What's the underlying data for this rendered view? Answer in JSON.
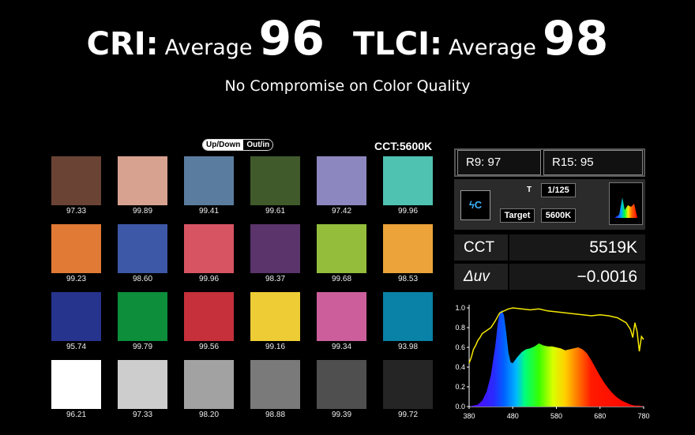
{
  "header": {
    "cri_label": "CRI:",
    "cri_avg_label": "Average",
    "cri_value": "96",
    "tlci_label": "TLCI:",
    "tlci_avg_label": "Average",
    "tlci_value": "98",
    "subtitle": "No Compromise on Color Quality"
  },
  "toggle": {
    "option_1": "Up/Down",
    "option_2": "Out/in"
  },
  "chart_title": "CCT:5600K",
  "swatches": [
    {
      "value": "97.33",
      "color": "#6a4335"
    },
    {
      "value": "99.89",
      "color": "#d8a291"
    },
    {
      "value": "99.41",
      "color": "#5a7c9e"
    },
    {
      "value": "99.61",
      "color": "#415a2b"
    },
    {
      "value": "97.42",
      "color": "#8c87bf"
    },
    {
      "value": "99.96",
      "color": "#4fc2b2"
    },
    {
      "value": "99.23",
      "color": "#e17a35"
    },
    {
      "value": "98.60",
      "color": "#3d58a6"
    },
    {
      "value": "99.96",
      "color": "#d75462"
    },
    {
      "value": "98.37",
      "color": "#5a346a"
    },
    {
      "value": "99.68",
      "color": "#94bd3c"
    },
    {
      "value": "98.53",
      "color": "#eca33a"
    },
    {
      "value": "95.74",
      "color": "#26348e"
    },
    {
      "value": "99.79",
      "color": "#0c8e3b"
    },
    {
      "value": "99.56",
      "color": "#c5303a"
    },
    {
      "value": "99.16",
      "color": "#eecc35"
    },
    {
      "value": "99.34",
      "color": "#cc5f9b"
    },
    {
      "value": "93.98",
      "color": "#0a81a6"
    },
    {
      "value": "96.21",
      "color": "#ffffff"
    },
    {
      "value": "97.33",
      "color": "#cdcdcd"
    },
    {
      "value": "98.20",
      "color": "#a2a2a2"
    },
    {
      "value": "98.88",
      "color": "#7a7a7a"
    },
    {
      "value": "99.39",
      "color": "#4f4f4f"
    },
    {
      "value": "99.72",
      "color": "#252525"
    }
  ],
  "meter": {
    "r9": "R9: 97",
    "r15": "R15: 95",
    "mode_icon": "flash-c-icon",
    "t_label": "T",
    "t_value": "1/125",
    "target_label": "Target",
    "target_value": "5600K",
    "cct_label": "CCT",
    "cct_value": "5519K",
    "duv_label": "Δuv",
    "duv_value": "−0.0016"
  },
  "chart_data": {
    "type": "area",
    "x_ticks": [
      "380",
      "480",
      "580",
      "680",
      "780"
    ],
    "y_ticks": [
      "0.0",
      "0.2",
      "0.4",
      "0.6",
      "0.8",
      "1.0"
    ],
    "xlim": [
      380,
      780
    ],
    "ylim": [
      0,
      1.0
    ],
    "series": [
      {
        "x": [
          380,
          400,
          410,
          420,
          430,
          440,
          445,
          450,
          455,
          460,
          465,
          470,
          475,
          480,
          490,
          500,
          510,
          520,
          530,
          540,
          550,
          560,
          570,
          580,
          590,
          600,
          610,
          620,
          630,
          640,
          650,
          660,
          670,
          680,
          690,
          700,
          710,
          720,
          730,
          740,
          750,
          760,
          770,
          780
        ],
        "values": [
          0,
          0.02,
          0.06,
          0.15,
          0.32,
          0.62,
          0.82,
          0.95,
          0.98,
          0.92,
          0.75,
          0.55,
          0.45,
          0.44,
          0.5,
          0.55,
          0.58,
          0.59,
          0.61,
          0.64,
          0.62,
          0.61,
          0.61,
          0.6,
          0.59,
          0.57,
          0.58,
          0.59,
          0.6,
          0.58,
          0.54,
          0.47,
          0.39,
          0.31,
          0.24,
          0.18,
          0.13,
          0.09,
          0.06,
          0.04,
          0.02,
          0.01,
          0.01,
          0
        ]
      },
      {
        "x": [
          380,
          385,
          390,
          395,
          400,
          405,
          410,
          420,
          430,
          440,
          450,
          460,
          470,
          480,
          500,
          520,
          540,
          560,
          580,
          600,
          620,
          640,
          660,
          680,
          700,
          720,
          740,
          750,
          755,
          760,
          765,
          770,
          775,
          780
        ],
        "values": [
          0.44,
          0.5,
          0.58,
          0.62,
          0.67,
          0.7,
          0.74,
          0.77,
          0.8,
          0.87,
          0.95,
          0.97,
          0.99,
          1.0,
          0.99,
          0.98,
          0.99,
          0.97,
          0.96,
          0.95,
          0.94,
          0.93,
          0.92,
          0.93,
          0.92,
          0.9,
          0.85,
          0.78,
          0.7,
          0.85,
          0.76,
          0.56,
          0.71,
          0.68
        ]
      }
    ]
  }
}
